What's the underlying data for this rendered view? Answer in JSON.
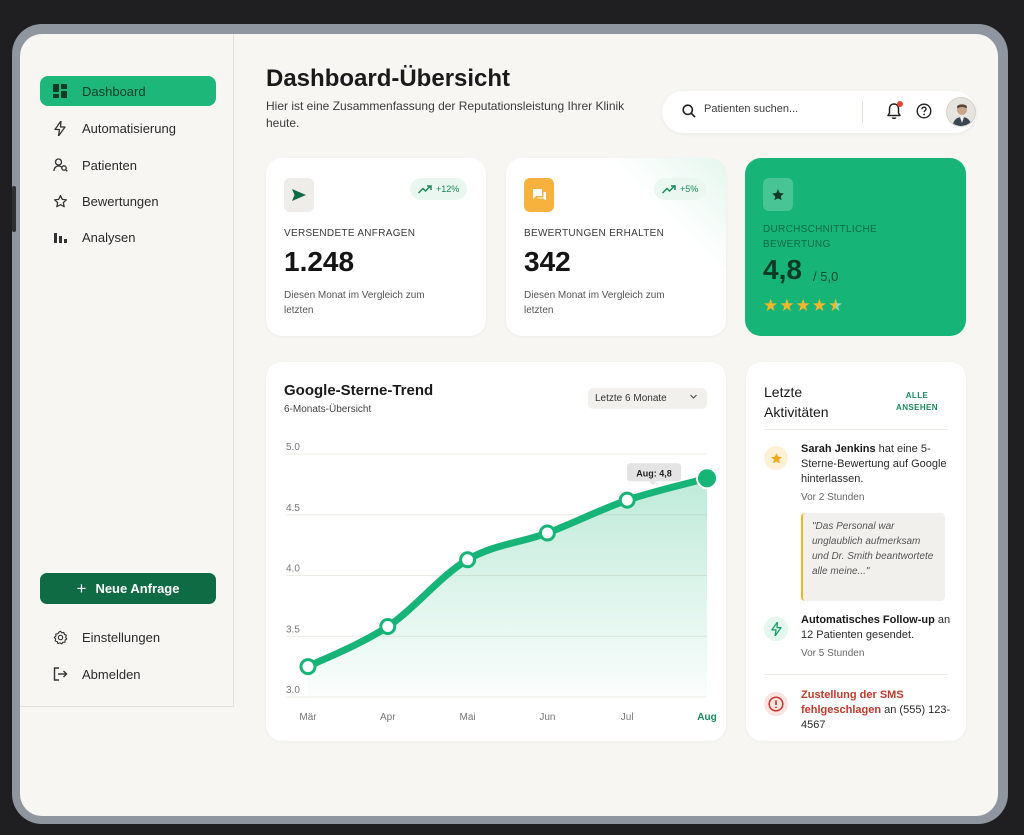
{
  "sidebar": {
    "nav": [
      {
        "label": "Dashboard",
        "icon": "dashboard-icon",
        "active": true
      },
      {
        "label": "Automatisierung",
        "icon": "bolt-icon",
        "active": false
      },
      {
        "label": "Patienten",
        "icon": "patients-icon",
        "active": false
      },
      {
        "label": "Bewertungen",
        "icon": "star-outline-icon",
        "active": false
      },
      {
        "label": "Analysen",
        "icon": "bar-chart-icon",
        "active": false
      }
    ],
    "new_request_label": "Neue Anfrage",
    "settings_label": "Einstellungen",
    "logout_label": "Abmelden"
  },
  "header": {
    "title": "Dashboard-Übersicht",
    "subtitle": "Hier ist eine Zusammenfassung der Reputationsleistung Ihrer Klinik heute.",
    "search_placeholder": "Patienten suchen..."
  },
  "stats": [
    {
      "label": "VERSENDETE ANFRAGEN",
      "value": "1.248",
      "trend": "+12%",
      "note": "Diesen Monat im Vergleich zum letzten",
      "icon": "send-icon"
    },
    {
      "label": "BEWERTUNGEN ERHALTEN",
      "value": "342",
      "trend": "+5%",
      "note": "Diesen Monat im Vergleich zum letzten",
      "icon": "chat-icon"
    }
  ],
  "rating": {
    "label": "DURCHSCHNITTLICHE BEWERTUNG",
    "value": "4,8",
    "scale": "/ 5,0",
    "stars": 4.5
  },
  "chart_card": {
    "title": "Google-Sterne-Trend",
    "subtitle": "6-Monats-Übersicht",
    "range": "Letzte 6 Monate",
    "tooltip": "Aug: 4,8"
  },
  "chart_data": {
    "type": "area",
    "categories": [
      "Mär",
      "Apr",
      "Mai",
      "Jun",
      "Jul",
      "Aug"
    ],
    "values": [
      3.25,
      3.58,
      4.13,
      4.35,
      4.62,
      4.8
    ],
    "ylim": [
      3.0,
      5.0
    ],
    "yticks": [
      "5.0",
      "4.5",
      "4.0",
      "3.5",
      "3.0"
    ],
    "ytick_values": [
      5.0,
      4.5,
      4.0,
      3.5,
      3.0
    ],
    "highlight_index": 5,
    "color": "#17b478",
    "grid": true
  },
  "activity": {
    "title": "Letzte Aktivitäten",
    "see_all": "ALLE ANSEHEN",
    "items": [
      {
        "name": "Sarah Jenkins",
        "text": " hat eine 5-Sterne-Bewertung auf Google hinterlassen.",
        "time": "Vor 2 Stunden",
        "quote": "\"Das Personal war unglaublich aufmerksam und Dr. Smith beantwortete alle meine...\""
      },
      {
        "name": "Automatisches Follow-up",
        "text": " an 12 Patienten gesendet.",
        "time": "Vor 5 Stunden"
      },
      {
        "name": "Zustellung der SMS fehlgeschlagen",
        "text": " an (555) 123-4567"
      }
    ]
  }
}
